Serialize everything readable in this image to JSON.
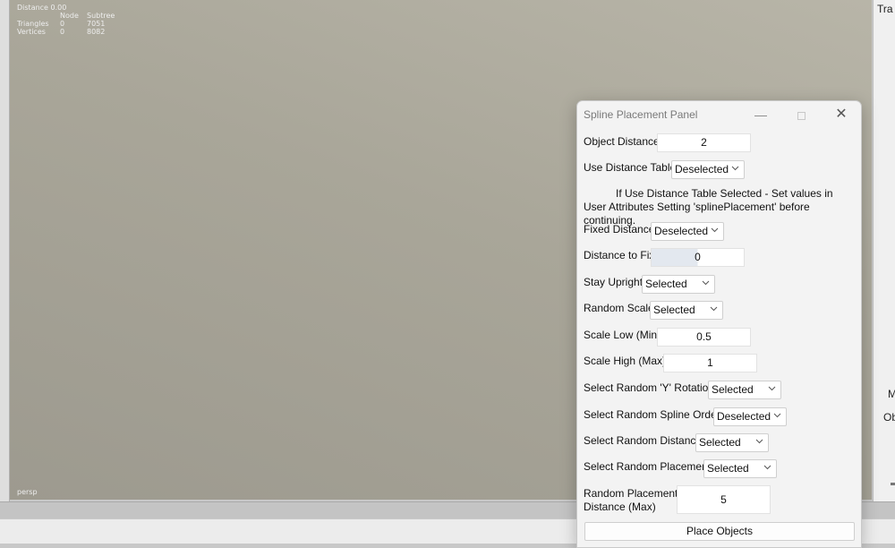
{
  "viewport": {
    "hud": {
      "distance": "Distance 0.00",
      "header_node": "Node",
      "header_subtree": "Subtree",
      "triangles_label": "Triangles",
      "triangles_node": "0",
      "triangles_subtree": "7051",
      "vertices_label": "Vertices",
      "vertices_node": "0",
      "vertices_subtree": "8082"
    },
    "camera_label": "persp"
  },
  "right_panel": {
    "tab_text": "Tra",
    "label_m": "M",
    "label_ob": "Ob"
  },
  "dialog": {
    "title": "Spline Placement Panel",
    "object_distance": {
      "label": "Object Distance",
      "value": "2"
    },
    "use_distance_table": {
      "label": "Use Distance Table",
      "value": "Deselected"
    },
    "note_line1": "If Use Distance Table Selected - Set values in",
    "note_line2": "User Attributes Setting 'splinePlacement' before continuing.",
    "fixed_distance": {
      "label": "Fixed Distance",
      "value": "Deselected"
    },
    "distance_to_fix": {
      "label": "Distance to Fix",
      "value": "0"
    },
    "stay_upright": {
      "label": "Stay Upright",
      "value": "Selected"
    },
    "random_scale": {
      "label": "Random Scale",
      "value": "Selected"
    },
    "scale_low": {
      "label": "Scale Low (Min)",
      "value": "0.5"
    },
    "scale_high": {
      "label": "Scale High (Max)",
      "value": "1"
    },
    "random_y_rotation": {
      "label": "Select Random 'Y' Rotation",
      "value": "Selected"
    },
    "random_spline_order": {
      "label": "Select Random Spline Order",
      "value": "Deselected"
    },
    "random_distance": {
      "label": "Select Random Distance",
      "value": "Selected"
    },
    "random_placement": {
      "label": "Select Random Placement",
      "value": "Selected"
    },
    "random_placement_distance": {
      "label_line1": "Random Placement",
      "label_line2": "Distance (Max)",
      "value": "5"
    },
    "place_button": "Place Objects"
  }
}
